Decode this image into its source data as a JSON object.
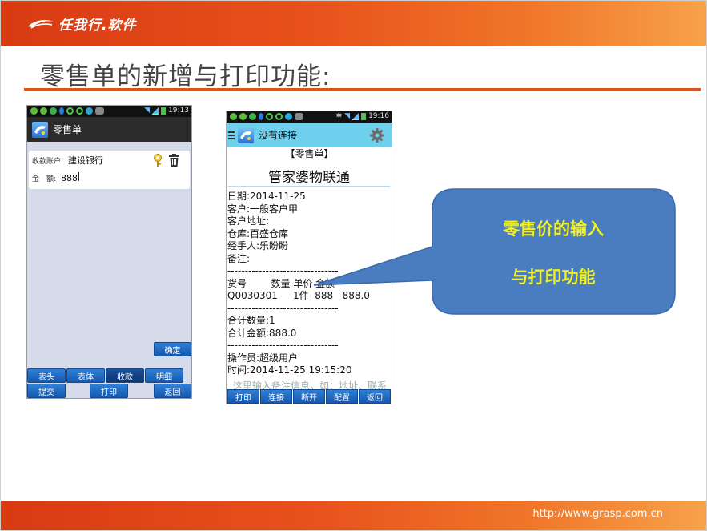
{
  "header": {
    "brand": "任我行.软件",
    "brand_color": "#e8521c"
  },
  "slide": {
    "title": "零售单的新增与打印功能:"
  },
  "footer": {
    "url": "http://www.grasp.com.cn"
  },
  "phone1": {
    "status_time": "19:13",
    "app_title": "零售单",
    "form": {
      "account_label": "收款账户:",
      "account_value": "建设银行",
      "amount_label": "金　额:",
      "amount_value": "888"
    },
    "confirm_button": "确定",
    "tabs": [
      "表头",
      "表体",
      "收款",
      "明细"
    ],
    "active_tab": "收款",
    "bottom_buttons": {
      "submit": "提交",
      "print": "打印",
      "back": "返回"
    }
  },
  "phone2": {
    "status_time": "19:16",
    "app_title": "没有连接",
    "receipt": {
      "doc_type": "【零售单】",
      "shop_name": "管家婆物联通",
      "lines": [
        "日期:2014-11-25",
        "客户:一般客户甲",
        "客户地址:",
        "仓库:百盛仓库",
        "经手人:乐盼盼",
        "备注:",
        "--------------------------------",
        "货号        数量 单价 金额",
        "Q0030301     1件  888   888.0",
        "--------------------------------",
        "合计数量:1",
        "合计金额:888.0",
        "--------------------------------",
        "操作员:超级用户",
        "时间:2014-11-25 19:15:20"
      ],
      "note_placeholder": "这里输入备注信息，如：地址、联系"
    },
    "buttons": [
      "打印",
      "连接",
      "断开",
      "配置",
      "返回"
    ]
  },
  "callout": {
    "line1": "零售价的输入",
    "line2": "与打印功能",
    "fill": "#4a7cc0",
    "text_color": "#f0f024"
  }
}
